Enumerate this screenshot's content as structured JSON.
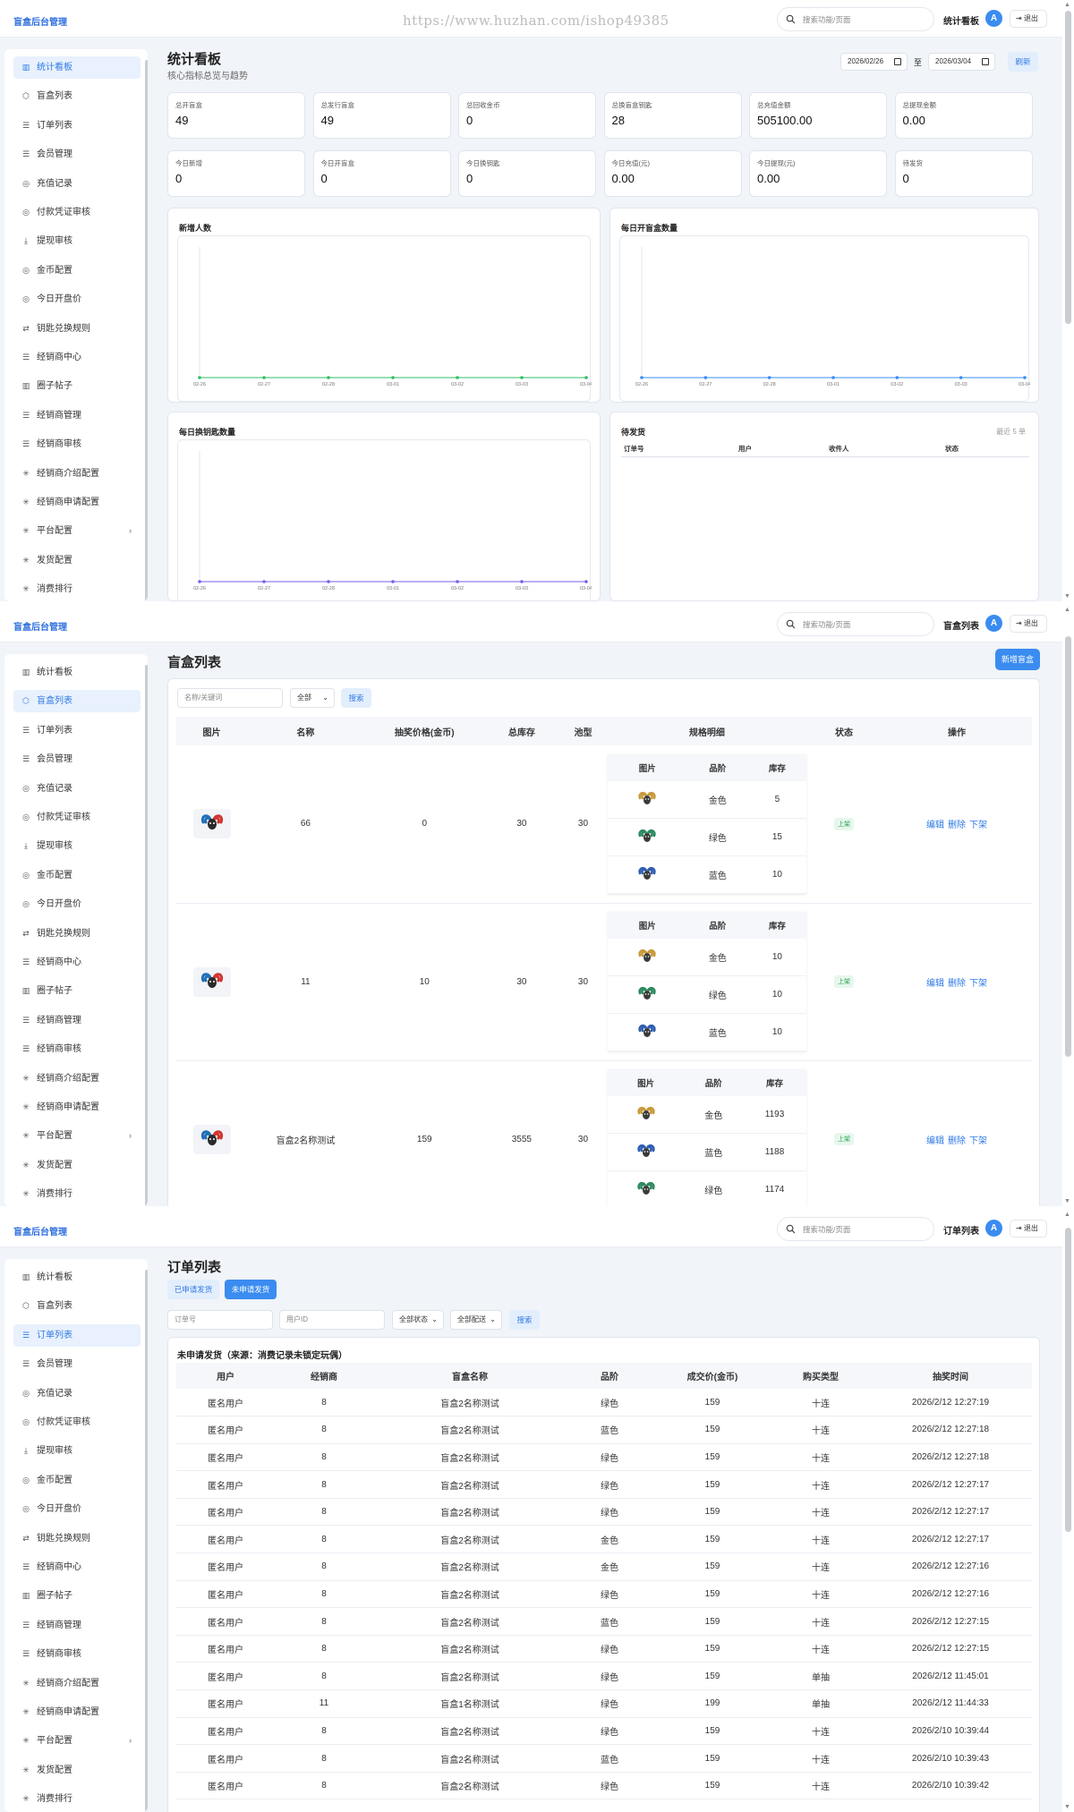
{
  "app": {
    "brand": "盲盒后台管理",
    "watermark": "https://www.huzhan.com/ishop49385",
    "search_placeholder": "搜索功能/页面",
    "avatar": "A",
    "logout": "退出"
  },
  "sidebar": {
    "items": [
      {
        "icon": "chart-icon",
        "glyph": "▥",
        "label": "统计看板"
      },
      {
        "icon": "box-icon",
        "glyph": "⬡",
        "label": "盲盒列表"
      },
      {
        "icon": "list-icon",
        "glyph": "☰",
        "label": "订单列表"
      },
      {
        "icon": "member-icon",
        "glyph": "☰",
        "label": "会员管理"
      },
      {
        "icon": "coin-icon",
        "glyph": "◎",
        "label": "充值记录"
      },
      {
        "icon": "voucher-icon",
        "glyph": "◎",
        "label": "付款凭证审核"
      },
      {
        "icon": "download-icon",
        "glyph": "⤓",
        "label": "提现审核"
      },
      {
        "icon": "coin-config-icon",
        "glyph": "◎",
        "label": "金币配置"
      },
      {
        "icon": "market-icon",
        "glyph": "◎",
        "label": "今日开盘价"
      },
      {
        "icon": "exchange-icon",
        "glyph": "⇄",
        "label": "钥匙兑换规则"
      },
      {
        "icon": "dealer-center-icon",
        "glyph": "☰",
        "label": "经销商中心"
      },
      {
        "icon": "posts-icon",
        "glyph": "▥",
        "label": "圈子帖子"
      },
      {
        "icon": "dealer-manage-icon",
        "glyph": "☰",
        "label": "经销商管理"
      },
      {
        "icon": "dealer-review-icon",
        "glyph": "☰",
        "label": "经销商审核"
      },
      {
        "icon": "intro-config-icon",
        "glyph": "✳",
        "label": "经销商介绍配置"
      },
      {
        "icon": "apply-config-icon",
        "glyph": "✳",
        "label": "经销商申请配置"
      },
      {
        "icon": "platform-config-icon",
        "glyph": "✳",
        "label": "平台配置",
        "expand": "›"
      },
      {
        "icon": "shipping-config-icon",
        "glyph": "✳",
        "label": "发货配置"
      },
      {
        "icon": "ranking-icon",
        "glyph": "✳",
        "label": "消费排行"
      }
    ]
  },
  "dashboard": {
    "current_page": "统计看板",
    "title": "统计看板",
    "subtitle": "核心指标总览与趋势",
    "date_from": "2026/02/26",
    "date_sep": "至",
    "date_to": "2026/03/04",
    "refresh": "刷新",
    "stats_row1": [
      {
        "label": "总开盲盒",
        "value": "49"
      },
      {
        "label": "总发行盲盒",
        "value": "49"
      },
      {
        "label": "总回收金币",
        "value": "0"
      },
      {
        "label": "总换盲盒钥匙",
        "value": "28"
      },
      {
        "label": "总充值金额",
        "value": "505100.00"
      },
      {
        "label": "总提现金额",
        "value": "0.00"
      }
    ],
    "stats_row2": [
      {
        "label": "今日新增",
        "value": "0"
      },
      {
        "label": "今日开盲盒",
        "value": "0"
      },
      {
        "label": "今日换钥匙",
        "value": "0"
      },
      {
        "label": "今日充值(元)",
        "value": "0.00"
      },
      {
        "label": "今日提现(元)",
        "value": "0.00"
      },
      {
        "label": "待发货",
        "value": "0"
      }
    ],
    "pending": {
      "title": "待发货",
      "hint": "最近 5 单",
      "columns": [
        "订单号",
        "用户",
        "收件人",
        "状态"
      ]
    }
  },
  "chart_data": [
    {
      "type": "line",
      "title": "新增人数",
      "x": [
        "02-26",
        "02-27",
        "02-28",
        "03-01",
        "03-02",
        "03-03",
        "03-04"
      ],
      "series": [
        {
          "values": [
            0,
            0,
            0,
            0,
            0,
            0,
            0
          ],
          "color": "#2fbf62"
        }
      ]
    },
    {
      "type": "line",
      "title": "每日开盲盒数量",
      "x": [
        "02-26",
        "02-27",
        "02-28",
        "03-01",
        "03-02",
        "03-03",
        "03-04"
      ],
      "series": [
        {
          "values": [
            0,
            0,
            0,
            0,
            0,
            0,
            0
          ],
          "color": "#3b8cf0"
        }
      ]
    },
    {
      "type": "line",
      "title": "每日换钥匙数量",
      "x": [
        "02-26",
        "02-27",
        "02-28",
        "03-01",
        "03-02",
        "03-03",
        "03-04"
      ],
      "series": [
        {
          "values": [
            0,
            0,
            0,
            0,
            0,
            0,
            0
          ],
          "color": "#7a5cf0"
        }
      ]
    }
  ],
  "boxes": {
    "current_page": "盲盒列表",
    "title": "盲盒列表",
    "new_button": "新增盲盒",
    "keyword_placeholder": "名称/关键词",
    "status_select": "全部",
    "search_button": "搜索",
    "columns": [
      "图片",
      "名称",
      "抽奖价格(金币)",
      "总库存",
      "池型",
      "规格明细",
      "状态",
      "操作"
    ],
    "spec_columns": [
      "图片",
      "品阶",
      "库存"
    ],
    "rows": [
      {
        "name": "66",
        "price": "0",
        "stock": "30",
        "pool": "30",
        "status": "上架",
        "specs": [
          {
            "grade": "金色",
            "stock": "5",
            "color": "#c89a3a"
          },
          {
            "grade": "绿色",
            "stock": "15",
            "color": "#2e8a5f"
          },
          {
            "grade": "蓝色",
            "stock": "10",
            "color": "#2f5fb0"
          }
        ]
      },
      {
        "name": "11",
        "price": "10",
        "stock": "30",
        "pool": "30",
        "status": "上架",
        "specs": [
          {
            "grade": "金色",
            "stock": "10",
            "color": "#c89a3a"
          },
          {
            "grade": "绿色",
            "stock": "10",
            "color": "#2e8a5f"
          },
          {
            "grade": "蓝色",
            "stock": "10",
            "color": "#2f5fb0"
          }
        ]
      },
      {
        "name": "盲盒2名称测试",
        "price": "159",
        "stock": "3555",
        "pool": "30",
        "status": "上架",
        "specs": [
          {
            "grade": "金色",
            "stock": "1193",
            "color": "#c89a3a"
          },
          {
            "grade": "蓝色",
            "stock": "1188",
            "color": "#2f5fb0"
          },
          {
            "grade": "绿色",
            "stock": "1174",
            "color": "#2e8a5f"
          }
        ]
      }
    ],
    "ops": {
      "edit": "编辑",
      "delete": "删除",
      "offshelf": "下架"
    }
  },
  "orders": {
    "current_page": "订单列表",
    "title": "订单列表",
    "tab_applied": "已申请发货",
    "tab_unapplied": "未申请发货",
    "order_placeholder": "订单号",
    "user_placeholder": "用户ID",
    "status_select": "全部状态",
    "delivery_select": "全部配送",
    "search_button": "搜索",
    "section_title": "未申请发货（来源：消费记录未锁定玩偶）",
    "columns": [
      "用户",
      "经销商",
      "盲盒名称",
      "品阶",
      "成交价(金币)",
      "购买类型",
      "抽奖时间"
    ],
    "rows": [
      [
        "匿名用户",
        "8",
        "盲盒2名称测试",
        "绿色",
        "159",
        "十连",
        "2026/2/12 12:27:19"
      ],
      [
        "匿名用户",
        "8",
        "盲盒2名称测试",
        "蓝色",
        "159",
        "十连",
        "2026/2/12 12:27:18"
      ],
      [
        "匿名用户",
        "8",
        "盲盒2名称测试",
        "绿色",
        "159",
        "十连",
        "2026/2/12 12:27:18"
      ],
      [
        "匿名用户",
        "8",
        "盲盒2名称测试",
        "绿色",
        "159",
        "十连",
        "2026/2/12 12:27:17"
      ],
      [
        "匿名用户",
        "8",
        "盲盒2名称测试",
        "绿色",
        "159",
        "十连",
        "2026/2/12 12:27:17"
      ],
      [
        "匿名用户",
        "8",
        "盲盒2名称测试",
        "金色",
        "159",
        "十连",
        "2026/2/12 12:27:17"
      ],
      [
        "匿名用户",
        "8",
        "盲盒2名称测试",
        "金色",
        "159",
        "十连",
        "2026/2/12 12:27:16"
      ],
      [
        "匿名用户",
        "8",
        "盲盒2名称测试",
        "绿色",
        "159",
        "十连",
        "2026/2/12 12:27:16"
      ],
      [
        "匿名用户",
        "8",
        "盲盒2名称测试",
        "蓝色",
        "159",
        "十连",
        "2026/2/12 12:27:15"
      ],
      [
        "匿名用户",
        "8",
        "盲盒2名称测试",
        "绿色",
        "159",
        "十连",
        "2026/2/12 12:27:15"
      ],
      [
        "匿名用户",
        "8",
        "盲盒2名称测试",
        "绿色",
        "159",
        "单抽",
        "2026/2/12 11:45:01"
      ],
      [
        "匿名用户",
        "11",
        "盲盒1名称测试",
        "绿色",
        "199",
        "单抽",
        "2026/2/12 11:44:33"
      ],
      [
        "匿名用户",
        "8",
        "盲盒2名称测试",
        "绿色",
        "159",
        "十连",
        "2026/2/10 10:39:44"
      ],
      [
        "匿名用户",
        "8",
        "盲盒2名称测试",
        "蓝色",
        "159",
        "十连",
        "2026/2/10 10:39:43"
      ],
      [
        "匿名用户",
        "8",
        "盲盒2名称测试",
        "绿色",
        "159",
        "十连",
        "2026/2/10 10:39:42"
      ]
    ]
  }
}
